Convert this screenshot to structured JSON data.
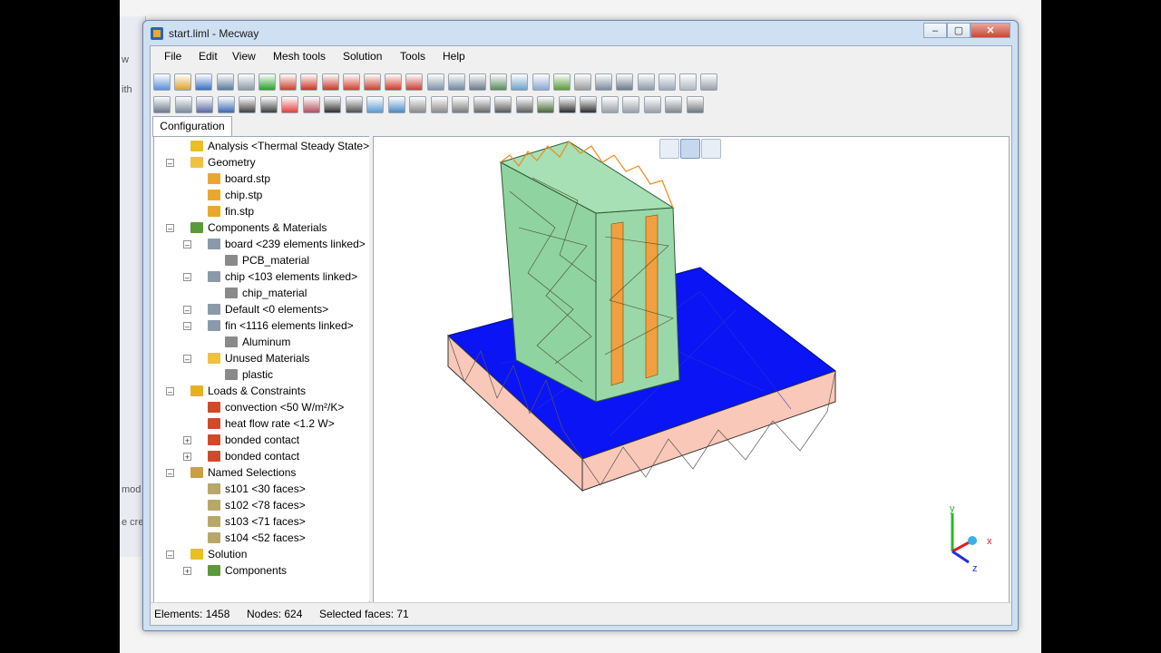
{
  "window": {
    "title": "start.liml - Mecway"
  },
  "background_window": {
    "fragments": [
      "w",
      "ith",
      "mod",
      "e cre"
    ]
  },
  "menu": [
    "File",
    "Edit",
    "View",
    "Mesh tools",
    "Solution",
    "Tools",
    "Help"
  ],
  "toolbar1_icons": [
    "new-icon",
    "open-icon",
    "save-icon",
    "undo-icon",
    "redo-icon",
    "solve-icon",
    "view-iso-icon",
    "view-front-icon",
    "view-back-icon",
    "view-left-icon",
    "view-right-icon",
    "view-top-icon",
    "view-bottom-icon",
    "zoom-fit-icon",
    "zoom-icon",
    "rotate-icon",
    "zoom-window-icon",
    "node-display-icon",
    "select-mode-icon",
    "wireframe-icon",
    "solid-icon",
    "shaded-icon",
    "edges-icon",
    "mesh-icon",
    "scroll-left-icon",
    "slider-icon",
    "scroll-right-icon"
  ],
  "toolbar2_icons": [
    "select-icon",
    "select-node-icon",
    "select-edge-icon",
    "select-face-icon",
    "node-tool-icon",
    "star-tool-icon",
    "box-tool-icon",
    "cube-tool-icon",
    "delete-icon",
    "split-icon",
    "refine-icon",
    "extrude-icon",
    "sweep-icon",
    "cylinder-icon",
    "revolve-icon",
    "bend-icon",
    "merge-icon",
    "scatter-icon",
    "mesh-2d-icon",
    "triangle-icon",
    "triangle-outline-icon",
    "shell-icon",
    "shell2-icon",
    "shell3-icon",
    "grid-icon",
    "table-icon"
  ],
  "config_tab": "Configuration",
  "tree": [
    {
      "label": "Analysis <Thermal Steady State>",
      "icon": "analysis-icon",
      "level": 0
    },
    {
      "label": "Geometry",
      "icon": "folder-icon",
      "level": 0
    },
    {
      "label": "board.stp",
      "icon": "geometry-file-icon",
      "level": 1
    },
    {
      "label": "chip.stp",
      "icon": "geometry-file-icon",
      "level": 1
    },
    {
      "label": "fin.stp",
      "icon": "geometry-file-icon",
      "level": 1
    },
    {
      "label": "Components & Materials",
      "icon": "components-icon",
      "level": 0
    },
    {
      "label": "board <239 elements linked>",
      "icon": "component-icon",
      "level": 1
    },
    {
      "label": "PCB_material",
      "icon": "material-icon",
      "level": 2
    },
    {
      "label": "chip <103 elements linked>",
      "icon": "component-icon",
      "level": 1
    },
    {
      "label": "chip_material",
      "icon": "material-icon",
      "level": 2
    },
    {
      "label": "Default <0 elements>",
      "icon": "component-icon",
      "level": 1
    },
    {
      "label": "fin <1116 elements linked>",
      "icon": "component-icon",
      "level": 1
    },
    {
      "label": "Aluminum",
      "icon": "material-icon",
      "level": 2
    },
    {
      "label": "Unused Materials",
      "icon": "folder-icon",
      "level": 1
    },
    {
      "label": "plastic",
      "icon": "material-icon",
      "level": 2
    },
    {
      "label": "Loads & Constraints",
      "icon": "loads-icon",
      "level": 0
    },
    {
      "label": "convection <50 W/m²/K>",
      "icon": "load-icon",
      "level": 1
    },
    {
      "label": "heat flow rate <1.2 W>",
      "icon": "load-icon",
      "level": 1
    },
    {
      "label": "bonded contact",
      "icon": "load-icon",
      "level": 1
    },
    {
      "label": "bonded contact",
      "icon": "load-icon",
      "level": 1
    },
    {
      "label": "Named Selections",
      "icon": "selections-icon",
      "level": 0
    },
    {
      "label": "s101 <30 faces>",
      "icon": "selection-icon",
      "level": 1
    },
    {
      "label": "s102 <78 faces>",
      "icon": "selection-icon",
      "level": 1
    },
    {
      "label": "s103 <71 faces>",
      "icon": "selection-icon",
      "level": 1
    },
    {
      "label": "s104 <52 faces>",
      "icon": "selection-icon",
      "level": 1
    },
    {
      "label": "Solution",
      "icon": "solution-icon",
      "level": 0
    },
    {
      "label": "Components",
      "icon": "components-icon",
      "level": 1
    }
  ],
  "viewport_icons": [
    "view-wireframe-icon",
    "view-transparent-icon",
    "view-solid-icon"
  ],
  "axes": {
    "x": "x",
    "y": "y",
    "z": "z"
  },
  "status": {
    "elements": "Elements: 1458",
    "nodes": "Nodes: 624",
    "selected": "Selected faces: 71"
  },
  "colors": {
    "fin": "#8fd3a0",
    "board_top": "#0a14f5",
    "board_side": "#f9c8b8",
    "highlight": "#f08a1c"
  }
}
